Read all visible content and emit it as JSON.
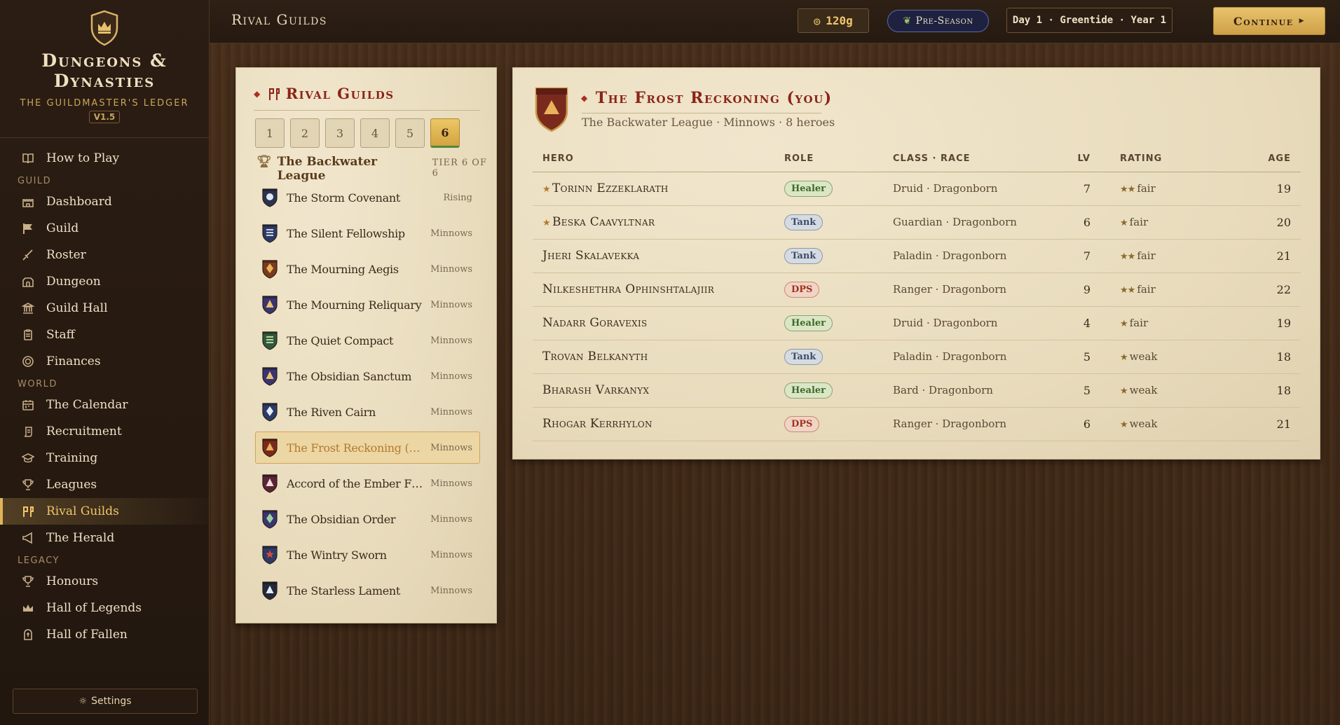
{
  "brand": {
    "title_line1": "Dungeons &",
    "title_line2": "Dynasties",
    "subtitle": "The Guildmaster's Ledger",
    "version": "V1.5"
  },
  "nav": {
    "top": [
      {
        "label": "How to Play",
        "icon": "book-icon"
      }
    ],
    "guild_section": "GUILD",
    "guild": [
      {
        "label": "Dashboard",
        "icon": "castle-icon"
      },
      {
        "label": "Guild",
        "icon": "flag-icon"
      },
      {
        "label": "Roster",
        "icon": "sword-icon"
      },
      {
        "label": "Dungeon",
        "icon": "dungeon-icon"
      },
      {
        "label": "Guild Hall",
        "icon": "hall-icon"
      },
      {
        "label": "Staff",
        "icon": "clipboard-icon"
      },
      {
        "label": "Finances",
        "icon": "coin-icon"
      }
    ],
    "world_section": "WORLD",
    "world": [
      {
        "label": "The Calendar",
        "icon": "calendar-icon"
      },
      {
        "label": "Recruitment",
        "icon": "scroll-icon"
      },
      {
        "label": "Training",
        "icon": "mortarboard-icon"
      },
      {
        "label": "Leagues",
        "icon": "trophy-icon"
      },
      {
        "label": "Rival Guilds",
        "icon": "banners-icon",
        "active": true
      },
      {
        "label": "The Herald",
        "icon": "megaphone-icon"
      }
    ],
    "legacy_section": "LEGACY",
    "legacy": [
      {
        "label": "Honours",
        "icon": "trophy-icon"
      },
      {
        "label": "Hall of Legends",
        "icon": "crown-icon"
      },
      {
        "label": "Hall of Fallen",
        "icon": "tomb-icon"
      }
    ],
    "settings_label": "Settings"
  },
  "topbar": {
    "title": "Rival Guilds",
    "gold": "120g",
    "season": "Pre-Season",
    "date": "Day 1 · Greentide · Year 1",
    "continue_label": "Continue"
  },
  "guild_panel": {
    "title": "Rival Guilds",
    "tiers": [
      "1",
      "2",
      "3",
      "4",
      "5",
      "6"
    ],
    "active_tier": "6",
    "league_name": "The Backwater League",
    "tier_of": "TIER 6 OF 6",
    "guilds": [
      {
        "name": "The Storm Covenant",
        "status": "Rising",
        "crest_bg": "#2a3350",
        "crest_mark": "circle",
        "mark_color": "#dfe6f2"
      },
      {
        "name": "The Silent Fellowship",
        "status": "Minnows",
        "crest_bg": "#2c3a66",
        "crest_mark": "lines",
        "mark_color": "#dfe6f2"
      },
      {
        "name": "The Mourning Aegis",
        "status": "Minnows",
        "crest_bg": "#7a3a1c",
        "crest_mark": "diamond",
        "mark_color": "#e8b35a"
      },
      {
        "name": "The Mourning Reliquary",
        "status": "Minnows",
        "crest_bg": "#3a3470",
        "crest_mark": "triangle",
        "mark_color": "#e8c070"
      },
      {
        "name": "The Quiet Compact",
        "status": "Minnows",
        "crest_bg": "#2f5a3a",
        "crest_mark": "lines",
        "mark_color": "#cfe2b0"
      },
      {
        "name": "The Obsidian Sanctum",
        "status": "Minnows",
        "crest_bg": "#3a3470",
        "crest_mark": "triangle",
        "mark_color": "#e8c070"
      },
      {
        "name": "The Riven Cairn",
        "status": "Minnows",
        "crest_bg": "#2c3a66",
        "crest_mark": "diamond",
        "mark_color": "#e6ecf6"
      },
      {
        "name": "The Frost Reckoning (you)",
        "status": "Minnows",
        "crest_bg": "#7a2a1c",
        "crest_mark": "triangle",
        "mark_color": "#e8b35a",
        "selected": true
      },
      {
        "name": "Accord of the Ember Flame",
        "status": "Minnows",
        "crest_bg": "#5a2438",
        "crest_mark": "triangle",
        "mark_color": "#f2dada"
      },
      {
        "name": "The Obsidian Order",
        "status": "Minnows",
        "crest_bg": "#3a3470",
        "crest_mark": "diamond",
        "mark_color": "#9ad2a0"
      },
      {
        "name": "The Wintry Sworn",
        "status": "Minnows",
        "crest_bg": "#2c3a66",
        "crest_mark": "star",
        "mark_color": "#d84a3a"
      },
      {
        "name": "The Starless Lament",
        "status": "Minnows",
        "crest_bg": "#23283a",
        "crest_mark": "triangle",
        "mark_color": "#e6ecf6"
      }
    ]
  },
  "detail": {
    "title": "The Frost Reckoning (you)",
    "subtitle": "The Backwater League · Minnows · 8 heroes",
    "crest_bg": "#7a2a1c",
    "columns": {
      "hero": "HERO",
      "role": "ROLE",
      "class_race": "CLASS · RACE",
      "lv": "LV",
      "rating": "RATING",
      "age": "AGE"
    },
    "heroes": [
      {
        "name": "Torinn Ezzeklarath",
        "starred": true,
        "role": "Healer",
        "class_race": "Druid · Dragonborn",
        "lv": "7",
        "stars": "★★",
        "rating": "fair",
        "age": "19"
      },
      {
        "name": "Beska Caavyltnar",
        "starred": true,
        "role": "Tank",
        "class_race": "Guardian · Dragonborn",
        "lv": "6",
        "stars": "★",
        "rating": "fair",
        "age": "20"
      },
      {
        "name": "Jheri Skalavekka",
        "starred": false,
        "role": "Tank",
        "class_race": "Paladin · Dragonborn",
        "lv": "7",
        "stars": "★★",
        "rating": "fair",
        "age": "21"
      },
      {
        "name": "Nilkeshethra Ophinshtalajiir",
        "starred": false,
        "role": "DPS",
        "class_race": "Ranger · Dragonborn",
        "lv": "9",
        "stars": "★★",
        "rating": "fair",
        "age": "22"
      },
      {
        "name": "Nadarr Goravexis",
        "starred": false,
        "role": "Healer",
        "class_race": "Druid · Dragonborn",
        "lv": "4",
        "stars": "★",
        "rating": "fair",
        "age": "19"
      },
      {
        "name": "Trovan Belkanyth",
        "starred": false,
        "role": "Tank",
        "class_race": "Paladin · Dragonborn",
        "lv": "5",
        "stars": "★",
        "rating": "weak",
        "age": "18"
      },
      {
        "name": "Bharash Varkanyx",
        "starred": false,
        "role": "Healer",
        "class_race": "Bard · Dragonborn",
        "lv": "5",
        "stars": "★",
        "rating": "weak",
        "age": "18"
      },
      {
        "name": "Rhogar Kerrhylon",
        "starred": false,
        "role": "DPS",
        "class_race": "Ranger · Dragonborn",
        "lv": "6",
        "stars": "★",
        "rating": "weak",
        "age": "21"
      }
    ]
  },
  "colors": {
    "accent_gold": "#e0b45a",
    "title_red": "#8a2418",
    "wood": "#3d2716",
    "parchment": "#e9dcbd"
  }
}
